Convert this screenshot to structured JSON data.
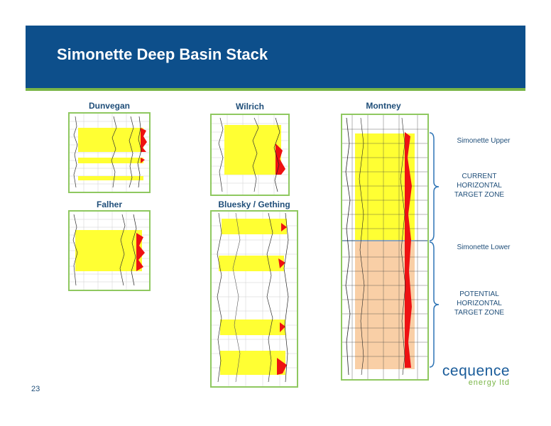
{
  "slide": {
    "title": "Simonette Deep Basin Stack",
    "page_number": "23"
  },
  "panels": {
    "dunvegan": "Dunvegan",
    "wilrich": "Wilrich",
    "montney": "Montney",
    "falher": "Falher",
    "bluesky": "Bluesky / Gething"
  },
  "annotations": {
    "simonette_upper": "Simonette Upper",
    "current_zone": [
      "CURRENT",
      "HORIZONTAL",
      "TARGET ZONE"
    ],
    "simonette_lower": "Simonette Lower",
    "potential_zone": [
      "POTENTIAL",
      "HORIZONTAL",
      "TARGET ZONE"
    ]
  },
  "logo": {
    "name": "cequence",
    "tagline": "energy ltd"
  },
  "colors": {
    "banner": "#0d4f8b",
    "accent_green": "#7ab648",
    "zone_yellow": "#ffff33",
    "zone_peach": "#f9cfa6",
    "log_red": "#ee1111"
  }
}
